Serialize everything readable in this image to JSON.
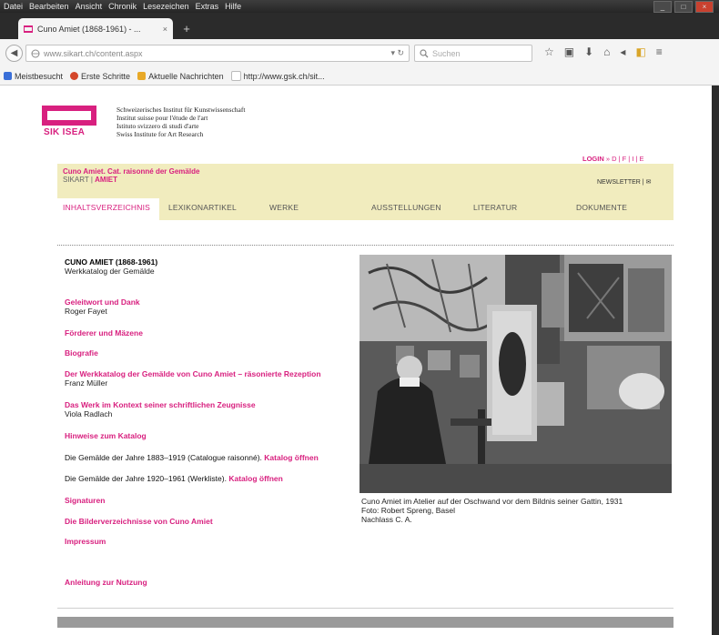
{
  "browser": {
    "menu": [
      "Datei",
      "Bearbeiten",
      "Ansicht",
      "Chronik",
      "Lesezeichen",
      "Extras",
      "Hilfe"
    ],
    "tab_title": "Cuno Amiet (1868-1961) - ...",
    "url": "www.sikart.ch/content.aspx",
    "search_placeholder": "Suchen",
    "bookmarks": [
      {
        "label": "Meistbesucht",
        "color": "#3a6fd8"
      },
      {
        "label": "Erste Schritte",
        "color": "#d4462a"
      },
      {
        "label": "Aktuelle Nachrichten",
        "color": "#e8a928"
      },
      {
        "label": "http://www.gsk.ch/sit...",
        "color": "#cccccc"
      }
    ],
    "window_controls": [
      "_",
      "□",
      "×"
    ]
  },
  "site": {
    "logo_text": "SIK ISEA",
    "institute_lines": [
      "Schweizerisches Institut für Kunstwissenschaft",
      "Institut suisse pour l'étude de l'art",
      "Istituto svizzero di studi d'arte",
      "Swiss Institute for Art Research"
    ],
    "login": "LOGIN",
    "languages": "D | F | I | E",
    "catalogue_title": "Cuno Amiet. Cat. raisonné der Gemälde",
    "breadcrumb_sikart": "SIKART",
    "breadcrumb_amiet": "AMIET",
    "newsletter": "NEWSLETTER",
    "nav": [
      "INHALTSVERZEICHNIS",
      "LEXIKONARTIKEL",
      "WERKE",
      "AUSSTELLUNGEN",
      "LITERATUR",
      "DOKUMENTE"
    ],
    "accent": "#d8207f",
    "band_color": "#f1ecbe"
  },
  "content": {
    "title": "CUNO AMIET (1868-1961)",
    "subtitle": "Werkkatalog der Gemälde",
    "entries": [
      {
        "link": "Geleitwort und Dank",
        "author": "Roger Fayet"
      },
      {
        "link": "Förderer und Mäzene",
        "author": ""
      },
      {
        "link": "Biografie",
        "author": ""
      },
      {
        "link": "Der Werkkatalog der Gemälde von Cuno Amiet – räsonierte Rezeption",
        "author": "Franz Müller"
      },
      {
        "link": "Das Werk im Kontext seiner schriftlichen Zeugnisse",
        "author": "Viola Radlach"
      },
      {
        "link": "Hinweise zum Katalog",
        "author": ""
      }
    ],
    "catalogue_1": {
      "text": "Die Gemälde der Jahre 1883–1919 (Catalogue raisonné).",
      "link": "Katalog öffnen"
    },
    "catalogue_2": {
      "text": "Die Gemälde der Jahre 1920–1961 (Werkliste).",
      "link": "Katalog öffnen"
    },
    "links_after": [
      "Signaturen",
      "Die Bilderverzeichnisse von Cuno Amiet",
      "Impressum"
    ],
    "usage_link": "Anleitung zur Nutzung",
    "caption": [
      "Cuno Amiet im Atelier auf der Oschwand vor dem Bildnis seiner Gattin, 1931",
      "Foto: Robert Spreng, Basel",
      "Nachlass C. A."
    ]
  }
}
